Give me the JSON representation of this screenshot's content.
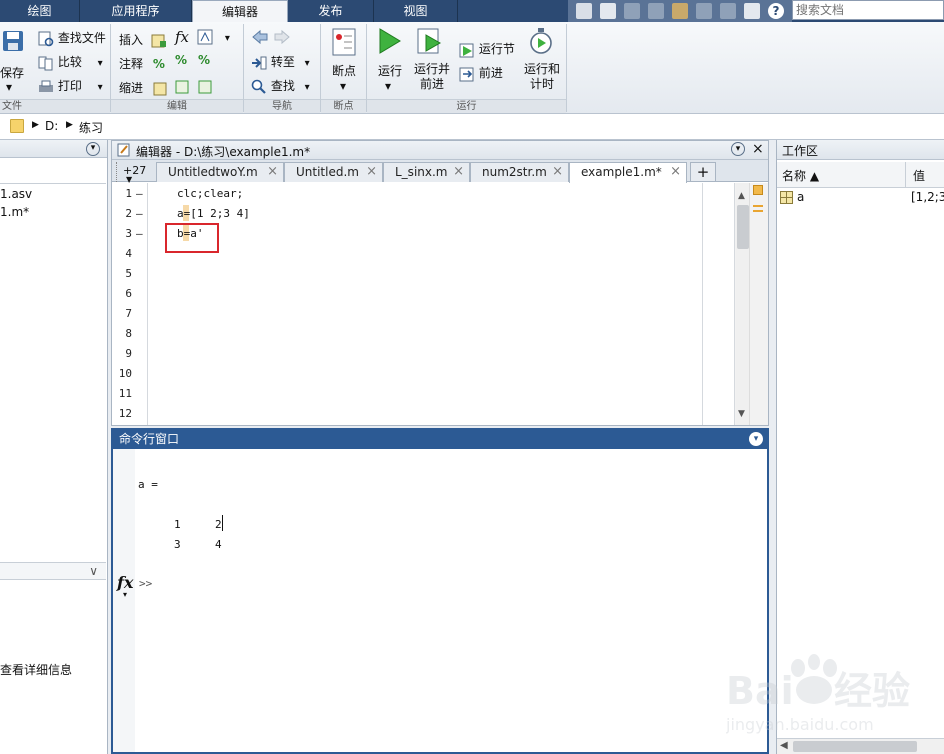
{
  "top_tabs": [
    {
      "label": "绘图"
    },
    {
      "label": "应用程序"
    },
    {
      "label": "编辑器"
    },
    {
      "label": "发布"
    },
    {
      "label": "视图"
    }
  ],
  "search": {
    "placeholder": "搜索文档"
  },
  "ribbon": {
    "file": {
      "save": "保存",
      "find_files": "查找文件",
      "compare": "比较",
      "print": "打印",
      "group": "文件"
    },
    "edit": {
      "insert": "插入",
      "comment": "注释",
      "indent": "缩进",
      "group": "编辑"
    },
    "navigate": {
      "go_to": "转至",
      "find": "查找",
      "group": "导航"
    },
    "breakpoints": {
      "breakpoints": "断点",
      "group": "断点"
    },
    "run": {
      "run": "运行",
      "run_advance": "运行并\n前进",
      "run_section": "运行节",
      "advance": "前进",
      "run_and_time": "运行和\n计时",
      "group": "运行"
    }
  },
  "address": {
    "drive": "D:",
    "folder": "练习"
  },
  "left_panel": {
    "files": [
      "1.asv",
      "1.m*"
    ],
    "details_link": "查看详细信息"
  },
  "editor": {
    "title": "编辑器 - D:\\练习\\example1.m*",
    "overflow_tabs": "+27",
    "tabs": [
      "UntitledtwoY.m",
      "Untitled.m",
      "L_sinx.m",
      "num2str.m",
      "example1.m*"
    ],
    "add_tab": "+",
    "lines": [
      {
        "n": "1",
        "mark": "–",
        "code": "clc;clear;"
      },
      {
        "n": "2",
        "mark": "–",
        "code": "a=[1 2;3 4]"
      },
      {
        "n": "3",
        "mark": "–",
        "code": "b=a'"
      },
      {
        "n": "4",
        "mark": "",
        "code": ""
      },
      {
        "n": "5",
        "mark": "",
        "code": ""
      },
      {
        "n": "6",
        "mark": "",
        "code": ""
      },
      {
        "n": "7",
        "mark": "",
        "code": ""
      },
      {
        "n": "8",
        "mark": "",
        "code": ""
      },
      {
        "n": "9",
        "mark": "",
        "code": ""
      },
      {
        "n": "10",
        "mark": "",
        "code": ""
      },
      {
        "n": "11",
        "mark": "",
        "code": ""
      },
      {
        "n": "12",
        "mark": "",
        "code": ""
      }
    ]
  },
  "command_window": {
    "title": "命令行窗口",
    "var_line": "a =",
    "row1": [
      "1",
      "2"
    ],
    "row2": [
      "3",
      "4"
    ],
    "prompt": ">>"
  },
  "workspace": {
    "title": "工作区",
    "col_name": "名称 ▲",
    "col_value": "值",
    "vars": [
      {
        "name": "a",
        "value": "[1,2;3,"
      }
    ]
  },
  "colors": {
    "title_bar": "#2c4a73",
    "command_title": "#2c5a94",
    "highlight_box": "#d9262c"
  }
}
